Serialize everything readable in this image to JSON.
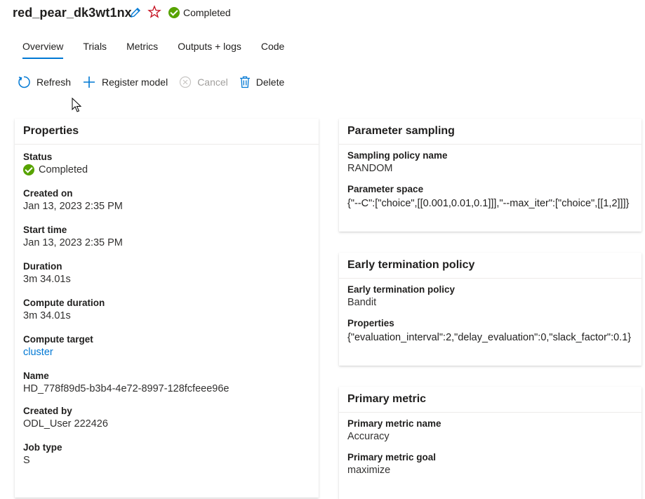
{
  "header": {
    "title": "red_pear_dk3wt1nx",
    "status": "Completed"
  },
  "tabs": [
    "Overview",
    "Trials",
    "Metrics",
    "Outputs + logs",
    "Code"
  ],
  "toolbar": {
    "refresh": "Refresh",
    "register": "Register model",
    "cancel": "Cancel",
    "delete": "Delete"
  },
  "properties": {
    "title": "Properties",
    "status_label": "Status",
    "status_value": "Completed",
    "created_on_label": "Created on",
    "created_on": "Jan 13, 2023 2:35 PM",
    "start_time_label": "Start time",
    "start_time": "Jan 13, 2023 2:35 PM",
    "duration_label": "Duration",
    "duration": "3m 34.01s",
    "compute_duration_label": "Compute duration",
    "compute_duration": "3m 34.01s",
    "compute_target_label": "Compute target",
    "compute_target": "cluster",
    "name_label": "Name",
    "name": "HD_778f89d5-b3b4-4e72-8997-128fcfeee96e",
    "created_by_label": "Created by",
    "created_by": "ODL_User 222426",
    "job_type_label": "Job type",
    "job_type": "S"
  },
  "sampling": {
    "title": "Parameter sampling",
    "policy_label": "Sampling policy name",
    "policy": "RANDOM",
    "space_label": "Parameter space",
    "space": "{\"--C\":[\"choice\",[[0.001,0.01,0.1]]],\"--max_iter\":[\"choice\",[[1,2]]]}"
  },
  "termination": {
    "title": "Early termination policy",
    "policy_label": "Early termination policy",
    "policy": "Bandit",
    "props_label": "Properties",
    "props": "{\"evaluation_interval\":2,\"delay_evaluation\":0,\"slack_factor\":0.1}"
  },
  "metric": {
    "title": "Primary metric",
    "name_label": "Primary metric name",
    "name": "Accuracy",
    "goal_label": "Primary metric goal",
    "goal": "maximize"
  },
  "colors": {
    "accent": "#0078d4",
    "success": "#57a300",
    "star": "#c50f1f"
  }
}
